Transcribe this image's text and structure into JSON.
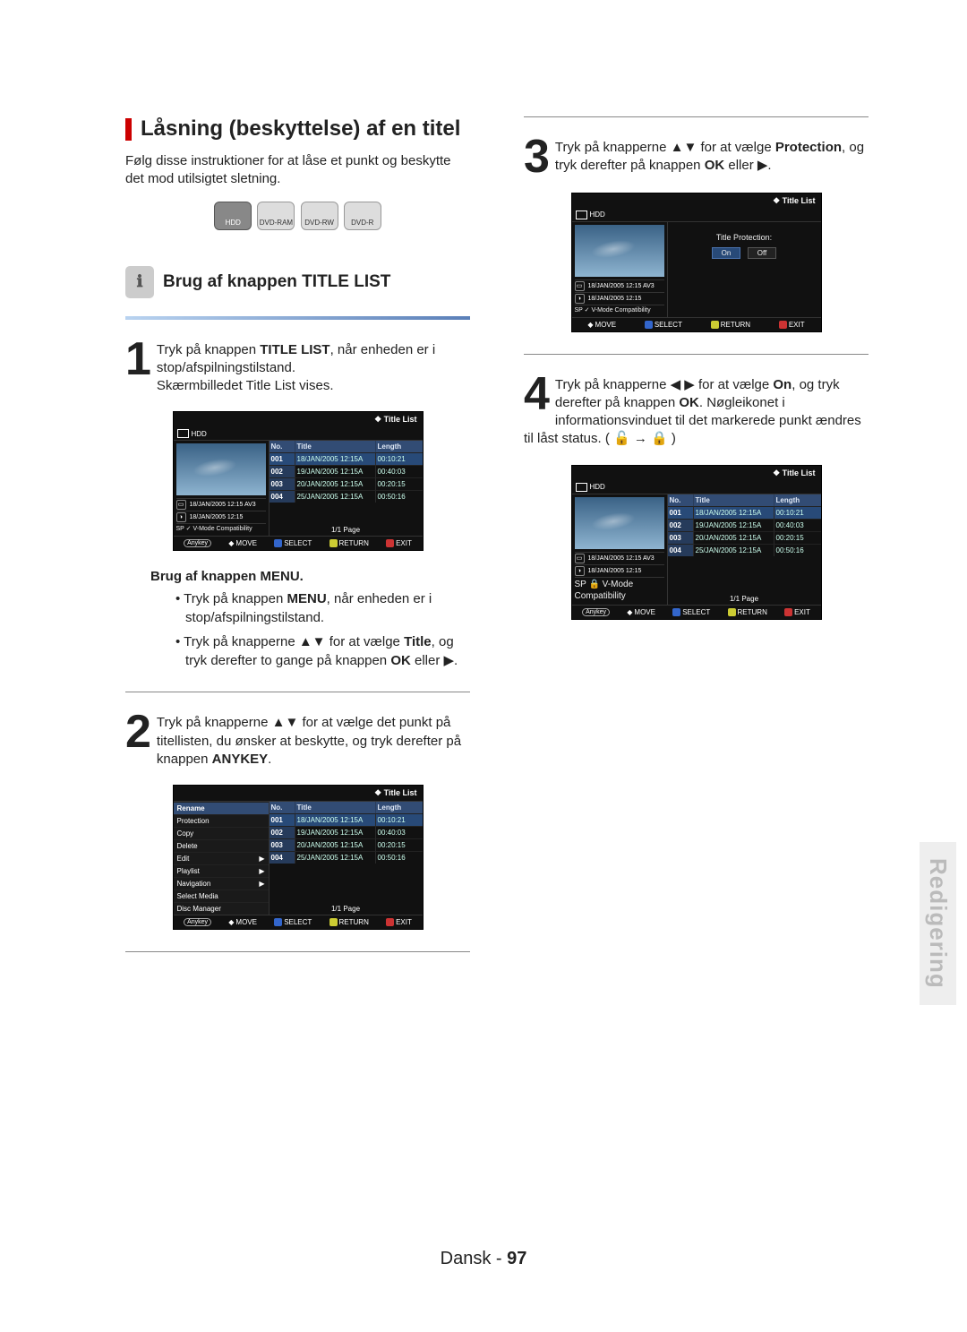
{
  "section_title": "Låsning (beskyttelse) af en titel",
  "intro": "Følg disse instruktioner for at låse et punkt og beskytte det mod utilsigtet sletning.",
  "discs": [
    "HDD",
    "DVD-RAM",
    "DVD-RW",
    "DVD-R"
  ],
  "subsection": "Brug af knappen TITLE LIST",
  "steps": {
    "s1_a": "Tryk på knappen ",
    "s1_bold": "TITLE LIST",
    "s1_b": ", når enheden er i stop/afspilningstilstand.",
    "s1_c": "Skærmbilledet Title List vises.",
    "menu_head": "Brug af knappen MENU.",
    "menu_b1_a": "Tryk på knappen ",
    "menu_b1_bold": "MENU",
    "menu_b1_b": ", når enheden er i stop/afspilningstilstand.",
    "menu_b2_a": "Tryk på knapperne ▲▼ for at vælge ",
    "menu_b2_bold": "Title",
    "menu_b2_b": ", og tryk derefter to gange på knappen ",
    "menu_b2_bold2": "OK",
    "menu_b2_c": " eller ▶.",
    "s2_a": "Tryk på knapperne ▲▼ for at vælge det punkt på titellisten, du ønsker at beskytte, og tryk derefter på knappen ",
    "s2_bold": "ANYKEY",
    "s2_b": ".",
    "s3_a": "Tryk på knapperne ▲▼ for at vælge ",
    "s3_bold": "Protection",
    "s3_b": ", og tryk derefter på knappen ",
    "s3_bold2": "OK",
    "s3_c": " eller ▶.",
    "s4_a": "Tryk på knapperne ◀ ▶ for at vælge ",
    "s4_bold": "On",
    "s4_b": ", og tryk derefter på knappen ",
    "s4_bold2": "OK",
    "s4_c": ". Nøgleikonet i informationsvinduet til det markerede punkt ændres til låst status. ( 🔓 → 🔒 )"
  },
  "ui": {
    "title_header": "Title List",
    "hdd": "HDD",
    "cols": [
      "No.",
      "Title",
      "Length"
    ],
    "rows": [
      {
        "no": "001",
        "title": "18/JAN/2005 12:15A",
        "len": "00:10:21"
      },
      {
        "no": "002",
        "title": "19/JAN/2005 12:15A",
        "len": "00:40:03"
      },
      {
        "no": "003",
        "title": "20/JAN/2005 12:15A",
        "len": "00:20:15"
      },
      {
        "no": "004",
        "title": "25/JAN/2005 12:15A",
        "len": "00:50:16"
      }
    ],
    "info1": "18/JAN/2005 12:15 AV3",
    "info2": "18/JAN/2005 12:15",
    "info3": "SP ✓ V-Mode Compatibility",
    "info3_lock": "SP 🔒 V-Mode Compatibility",
    "page": "1/1 Page",
    "footer": {
      "anykey": "Anykey",
      "move": "MOVE",
      "select": "SELECT",
      "ret": "RETURN",
      "exit": "EXIT"
    },
    "menu_items": [
      "Rename",
      "Protection",
      "Copy",
      "Delete",
      "Edit",
      "Playlist",
      "Navigation",
      "Select Media",
      "Disc Manager"
    ],
    "arrow_items": [
      "Edit",
      "Playlist",
      "Navigation"
    ],
    "protection_label": "Title Protection:",
    "on": "On",
    "off": "Off"
  },
  "sidebar": "Redigering",
  "footer_lang": "Dansk",
  "footer_page": "97"
}
